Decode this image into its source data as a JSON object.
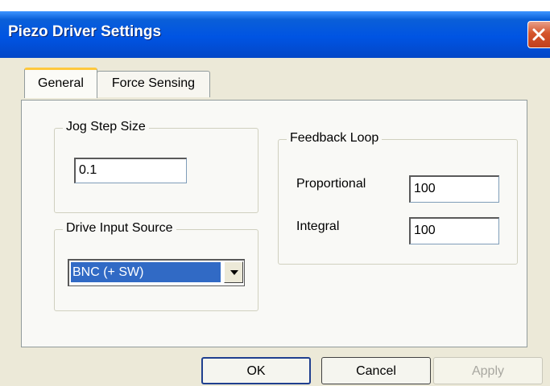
{
  "window": {
    "title": "Piezo Driver Settings",
    "close_icon": "close-x-icon"
  },
  "tabs": [
    {
      "label": "General",
      "selected": true
    },
    {
      "label": "Force Sensing",
      "selected": false
    }
  ],
  "jog_step": {
    "group_label": "Jog Step Size",
    "value": "0.1"
  },
  "drive_input": {
    "group_label": "Drive Input Source",
    "selected": "BNC (+ SW)",
    "dropdown_icon": "chevron-down-icon"
  },
  "feedback": {
    "group_label": "Feedback Loop",
    "proportional_label": "Proportional",
    "proportional_value": "100",
    "integral_label": "Integral",
    "integral_value": "100"
  },
  "buttons": {
    "ok": "OK",
    "cancel": "Cancel",
    "apply": "Apply",
    "apply_enabled": false
  },
  "colors": {
    "titlebar": "#0054e3",
    "selection": "#316ac5",
    "close": "#d5552c",
    "tab_highlight": "#ffc83c"
  }
}
